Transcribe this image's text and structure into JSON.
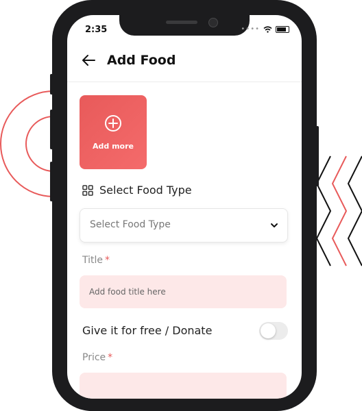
{
  "status_bar": {
    "time": "2:35"
  },
  "header": {
    "title": "Add Food",
    "back_icon": "arrow-left-icon"
  },
  "upload": {
    "label": "Add more",
    "icon": "plus-circle-icon"
  },
  "food_type": {
    "section_label": "Select Food Type",
    "section_icon": "grid-icon",
    "select_value": "Select Food Type",
    "chevron_icon": "chevron-down-icon"
  },
  "title_field": {
    "label": "Title",
    "required_mark": "*",
    "placeholder": "Add food title here"
  },
  "donate": {
    "label": "Give it for free / Donate",
    "enabled": false
  },
  "price_field": {
    "label": "Price",
    "required_mark": "*"
  },
  "colors": {
    "accent": "#E85A5A",
    "input_bg": "#FDE8E8"
  }
}
